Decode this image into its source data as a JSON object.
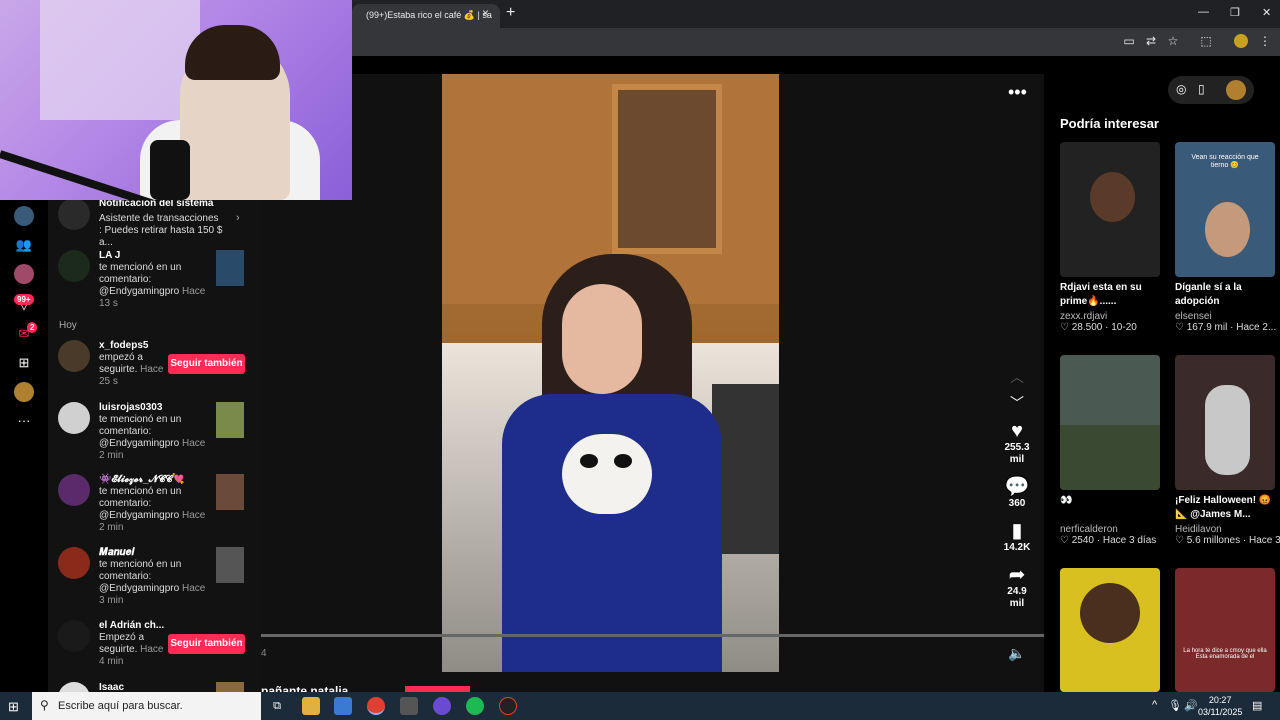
{
  "browser": {
    "tab_title": "(99+)Estaba rico el café 💰 | sa",
    "tab_close": "×",
    "new_tab": "+",
    "win_min": "—",
    "win_restore": "❐",
    "win_close": "✕"
  },
  "notifications": {
    "system_title": "Notificación del sistema",
    "system_text": "Asistente de transacciones : Puedes retirar hasta 150 $ a...",
    "today_label": "Hoy",
    "follow_label": "Seguir también",
    "items": [
      {
        "name": "LA J",
        "text": "te mencionó en un comentario: @Endygamingpro",
        "time": "Hace 13 s"
      },
      {
        "name": "x_fodeps5",
        "text": "empezó a seguirte.",
        "time": "Hace 25 s"
      },
      {
        "name": "luisrojas0303",
        "text": "te mencionó en un comentario: @Endygamingpro",
        "time": "Hace 2 min"
      },
      {
        "name": "👾𝓔𝓵𝓲𝓮𝔃𝓮𝓻_𝓝𝓒𝓒💘",
        "text": "te mencionó en un comentario: @Endygamingpro",
        "time": "Hace 2 min"
      },
      {
        "name": "𝑴𝒂𝒏𝒖𝒆𝒍",
        "text": "te mencionó en un comentario: @Endygamingpro",
        "time": "Hace 3 min"
      },
      {
        "name": "el Adrián ch...",
        "text": "Empezó a seguirte.",
        "time": "Hace 4 min"
      },
      {
        "name": "Isaac",
        "text": "",
        "time": ""
      }
    ]
  },
  "leftnav": {
    "badge_activity": "99+",
    "badge_messages": "2",
    "more": "···"
  },
  "video": {
    "likes": "255.3 mil",
    "comments": "360",
    "saves": "14.2K",
    "shares": "24.9 mil",
    "time_label": "4",
    "caption_user": "pañante natalia"
  },
  "recommend": {
    "title": "Podría interesar",
    "cards": [
      {
        "caption": "Rdjavi esta en su prime🔥......",
        "user": "zexx.rdjavi",
        "likes": "28.500",
        "date": "10-20",
        "overlay": ""
      },
      {
        "caption": "Díganle sí a la adopción",
        "user": "elsensei",
        "likes": "167.9 mil",
        "date": "Hace 2...",
        "overlay": "Vean su reacción que tierno 😊"
      },
      {
        "caption": "👀",
        "user": "nerficalderon",
        "likes": "2540",
        "date": "Hace 3 días",
        "overlay": ""
      },
      {
        "caption": "¡Feliz Halloween! 😡 📐 @James M...",
        "user": "Heidilavon",
        "likes": "5.6 millones",
        "date": "Hace 3...",
        "overlay": ""
      },
      {
        "caption": "",
        "user": "",
        "likes": "",
        "date": "",
        "overlay": ""
      },
      {
        "caption": "",
        "user": "",
        "likes": "",
        "date": "",
        "overlay": "La hora te dice a cmoy que ella Esta enamorada de el"
      }
    ]
  },
  "taskbar": {
    "search_placeholder": "Escribe aquí para buscar.",
    "time": "20:27",
    "date": "03/11/2025"
  }
}
